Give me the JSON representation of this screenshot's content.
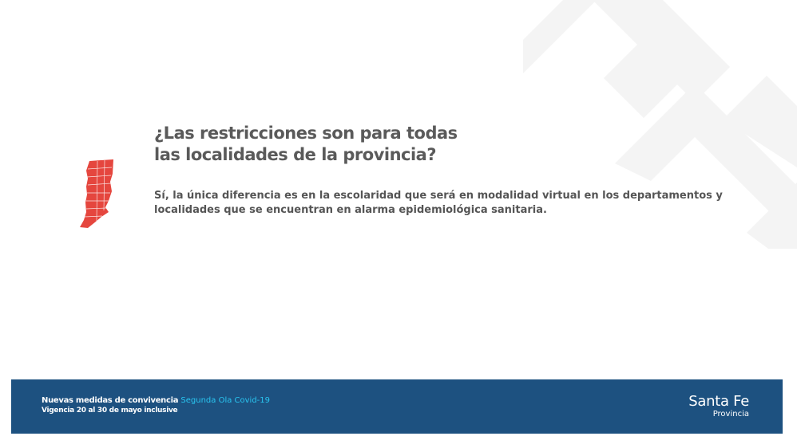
{
  "slide": {
    "question_lines": [
      "¿Las restricciones son para todas",
      "las localidades de la provincia?"
    ],
    "answer_lines": [
      "Sí, la única diferencia es en la escolaridad que será en modalidad virtual en los departamentos y",
      "localidades que se encuentran en alarma epidemiológica sanitaria."
    ]
  },
  "footer": {
    "title": "Nuevas medidas de convivencia",
    "subtitle": "Segunda Ola Covid-19",
    "dates": "Vigencia 20 al 30 de mayo inclusive",
    "brand_name": "Santa Fe",
    "brand_sub": "Provincia"
  },
  "colors": {
    "heading": "#5a5a5a",
    "body": "#555555",
    "footer_bg": "#1d5180",
    "accent": "#29c5f0",
    "map_fill": "#e5463e",
    "decoration": "#f4f4f4"
  },
  "icons": {
    "map": "santa-fe-province-map-icon",
    "decoration": "chevron-watermark"
  }
}
